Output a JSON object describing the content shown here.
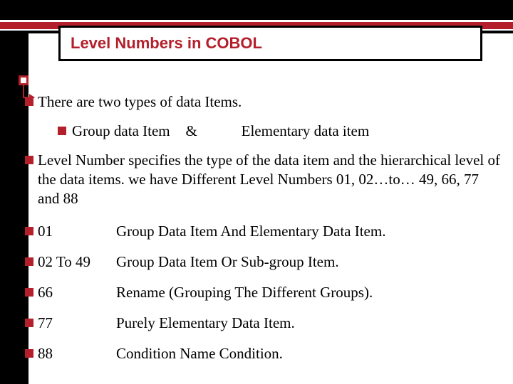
{
  "title": "Level Numbers in COBOL",
  "intro": "There are two types of data Items.",
  "types_line": {
    "group": "Group data Item",
    "amp": "&",
    "elementary": "Elementary data item"
  },
  "level_desc": "Level Number specifies the type of the data item and the hierarchical level of the data items. we have Different Level Numbers 01, 02…to… 49, 66, 77 and 88",
  "rows": [
    {
      "num": "01",
      "desc": "Group Data Item And Elementary Data Item."
    },
    {
      "num": "02 To 49",
      "desc": "Group Data Item Or Sub-group Item."
    },
    {
      "num": "66",
      "desc": "Rename (Grouping The Different Groups)."
    },
    {
      "num": "77",
      "desc": "Purely Elementary Data Item."
    },
    {
      "num": "88",
      "desc": "Condition Name Condition."
    }
  ]
}
